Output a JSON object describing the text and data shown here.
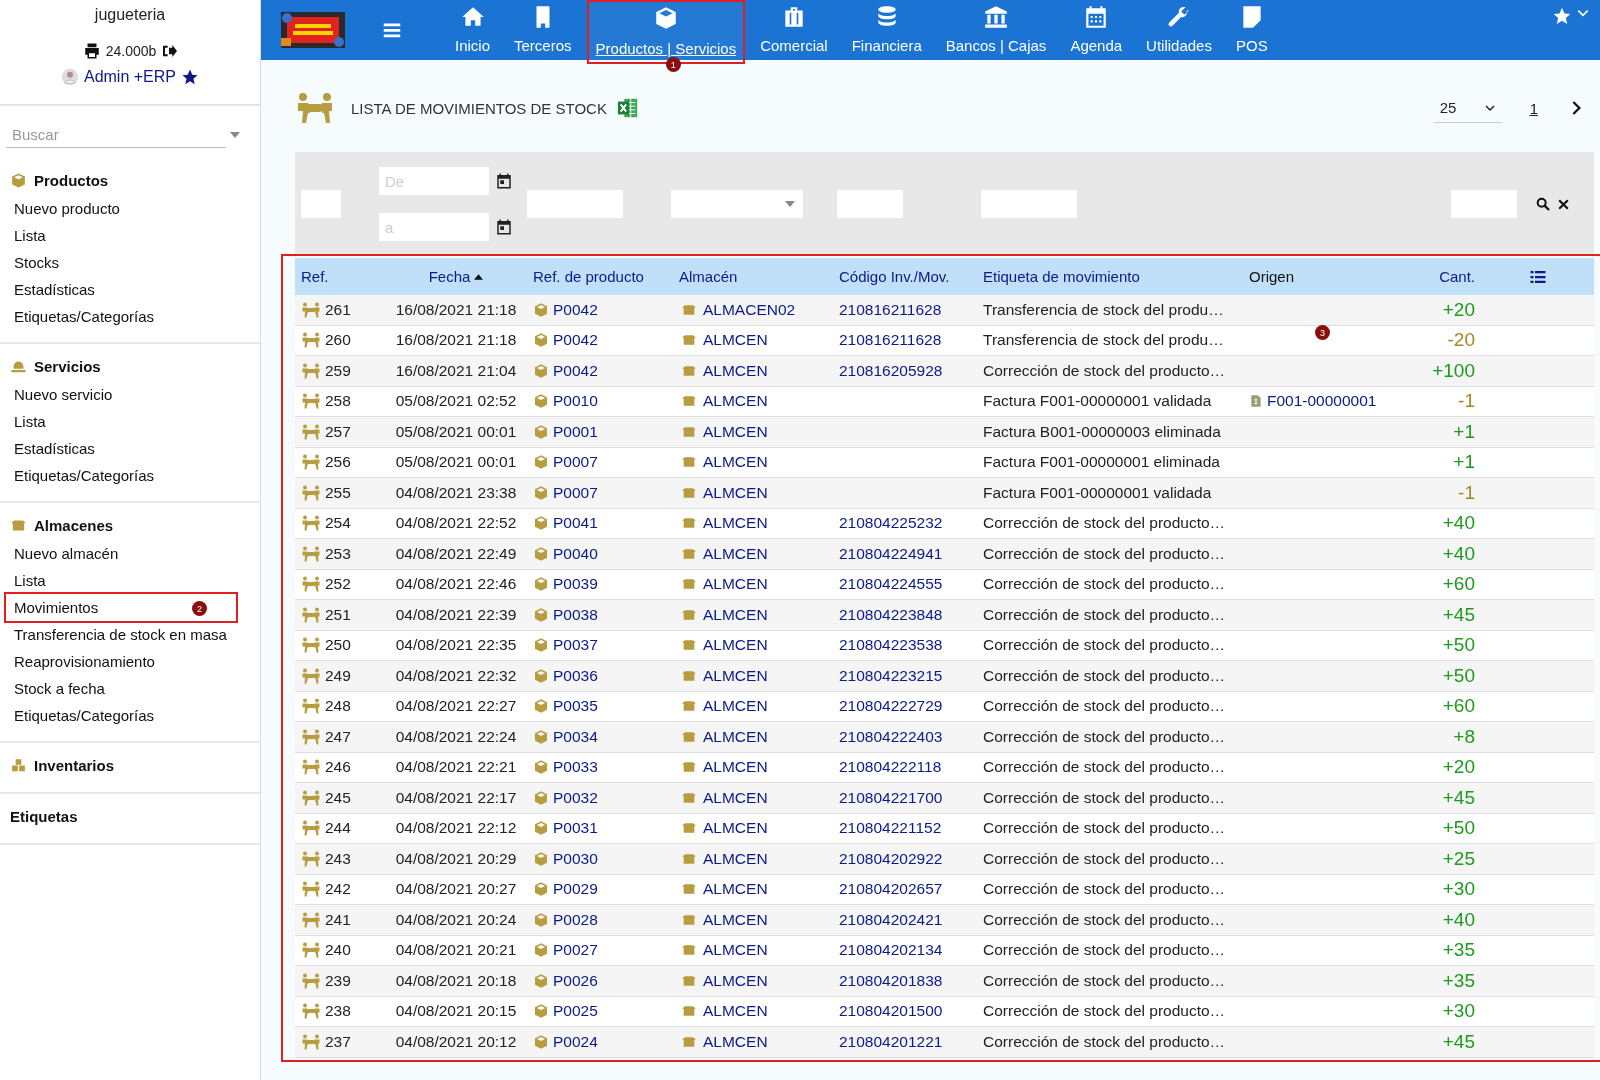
{
  "company": "jugueteria",
  "user_bar": {
    "printer_label": "24.000b",
    "user": "Admin +ERP"
  },
  "nav": [
    {
      "label": "Inicio",
      "selected": false
    },
    {
      "label": "Terceros",
      "selected": false
    },
    {
      "label": "Productos | Servicios",
      "selected": true,
      "annotation": "1"
    },
    {
      "label": "Comercial",
      "selected": false
    },
    {
      "label": "Financiera",
      "selected": false
    },
    {
      "label": "Bancos | Cajas",
      "selected": false
    },
    {
      "label": "Agenda",
      "selected": false
    },
    {
      "label": "Utilidades",
      "selected": false
    },
    {
      "label": "POS",
      "selected": false
    }
  ],
  "search": {
    "placeholder": "Buscar"
  },
  "sidebar": [
    {
      "title": "Productos",
      "items": [
        {
          "label": "Nuevo producto"
        },
        {
          "label": "Lista"
        },
        {
          "label": "Stocks"
        },
        {
          "label": "Estadísticas"
        },
        {
          "label": "Etiquetas/Categorías"
        }
      ]
    },
    {
      "title": "Servicios",
      "items": [
        {
          "label": "Nuevo servicio"
        },
        {
          "label": "Lista"
        },
        {
          "label": "Estadísticas"
        },
        {
          "label": "Etiquetas/Categorías"
        }
      ]
    },
    {
      "title": "Almacenes",
      "items": [
        {
          "label": "Nuevo almacén"
        },
        {
          "label": "Lista"
        },
        {
          "label": "Movimientos",
          "annotation": "2"
        },
        {
          "label": "Transferencia de stock en masa"
        },
        {
          "label": "Reaprovisionamiento"
        },
        {
          "label": "Stock a fecha"
        },
        {
          "label": "Etiquetas/Categorías"
        }
      ]
    },
    {
      "title": "Inventarios"
    },
    {
      "title": "Etiquetas"
    }
  ],
  "page_title": "LISTA DE MOVIMIENTOS DE STOCK",
  "pagination": {
    "page_size": "25",
    "page": "1"
  },
  "filters": {
    "date_from_placeholder": "De",
    "date_to_placeholder": "a"
  },
  "table": {
    "annotation": "3",
    "columns": [
      {
        "label": "Ref.",
        "sortable": true
      },
      {
        "label": "Fecha",
        "sortable": true
      },
      {
        "label": "Ref. de producto",
        "sortable": true
      },
      {
        "label": "Almacén",
        "sortable": true
      },
      {
        "label": "Código Inv./Mov.",
        "sortable": true
      },
      {
        "label": "Etiqueta de movimiento",
        "sortable": true
      },
      {
        "label": "Origen",
        "sortable": false
      },
      {
        "label": "Cant.",
        "sortable": true
      }
    ],
    "rows": [
      {
        "ref": "261",
        "date": "16/08/2021 21:18",
        "product": "P0042",
        "warehouse": "ALMACEN02",
        "code": "210816211628",
        "label": "Transferencia de stock del produ…",
        "qty": "+20",
        "incoming": true
      },
      {
        "ref": "260",
        "date": "16/08/2021 21:18",
        "product": "P0042",
        "warehouse": "ALMCEN",
        "code": "210816211628",
        "label": "Transferencia de stock del produ…",
        "qty": "-20",
        "incoming": false
      },
      {
        "ref": "259",
        "date": "16/08/2021 21:04",
        "product": "P0042",
        "warehouse": "ALMCEN",
        "code": "210816205928",
        "label": "Corrección de stock del producto…",
        "qty": "+100",
        "incoming": true
      },
      {
        "ref": "258",
        "date": "05/08/2021 02:52",
        "product": "P0010",
        "warehouse": "ALMCEN",
        "label": "Factura F001-00000001 validada",
        "origin": "F001-00000001",
        "qty": "-1",
        "incoming": false
      },
      {
        "ref": "257",
        "date": "05/08/2021 00:01",
        "product": "P0001",
        "warehouse": "ALMCEN",
        "label": "Factura B001-00000003 eliminada",
        "qty": "+1",
        "incoming": true
      },
      {
        "ref": "256",
        "date": "05/08/2021 00:01",
        "product": "P0007",
        "warehouse": "ALMCEN",
        "label": "Factura F001-00000001 eliminada",
        "qty": "+1",
        "incoming": true
      },
      {
        "ref": "255",
        "date": "04/08/2021 23:38",
        "product": "P0007",
        "warehouse": "ALMCEN",
        "label": "Factura F001-00000001 validada",
        "qty": "-1",
        "incoming": false
      },
      {
        "ref": "254",
        "date": "04/08/2021 22:52",
        "product": "P0041",
        "warehouse": "ALMCEN",
        "code": "210804225232",
        "label": "Corrección de stock del producto…",
        "qty": "+40",
        "incoming": true
      },
      {
        "ref": "253",
        "date": "04/08/2021 22:49",
        "product": "P0040",
        "warehouse": "ALMCEN",
        "code": "210804224941",
        "label": "Corrección de stock del producto…",
        "qty": "+40",
        "incoming": true
      },
      {
        "ref": "252",
        "date": "04/08/2021 22:46",
        "product": "P0039",
        "warehouse": "ALMCEN",
        "code": "210804224555",
        "label": "Corrección de stock del producto…",
        "qty": "+60",
        "incoming": true
      },
      {
        "ref": "251",
        "date": "04/08/2021 22:39",
        "product": "P0038",
        "warehouse": "ALMCEN",
        "code": "210804223848",
        "label": "Corrección de stock del producto…",
        "qty": "+45",
        "incoming": true
      },
      {
        "ref": "250",
        "date": "04/08/2021 22:35",
        "product": "P0037",
        "warehouse": "ALMCEN",
        "code": "210804223538",
        "label": "Corrección de stock del producto…",
        "qty": "+50",
        "incoming": true
      },
      {
        "ref": "249",
        "date": "04/08/2021 22:32",
        "product": "P0036",
        "warehouse": "ALMCEN",
        "code": "210804223215",
        "label": "Corrección de stock del producto…",
        "qty": "+50",
        "incoming": true
      },
      {
        "ref": "248",
        "date": "04/08/2021 22:27",
        "product": "P0035",
        "warehouse": "ALMCEN",
        "code": "210804222729",
        "label": "Corrección de stock del producto…",
        "qty": "+60",
        "incoming": true
      },
      {
        "ref": "247",
        "date": "04/08/2021 22:24",
        "product": "P0034",
        "warehouse": "ALMCEN",
        "code": "210804222403",
        "label": "Corrección de stock del producto…",
        "qty": "+8",
        "incoming": true
      },
      {
        "ref": "246",
        "date": "04/08/2021 22:21",
        "product": "P0033",
        "warehouse": "ALMCEN",
        "code": "210804222118",
        "label": "Corrección de stock del producto…",
        "qty": "+20",
        "incoming": true
      },
      {
        "ref": "245",
        "date": "04/08/2021 22:17",
        "product": "P0032",
        "warehouse": "ALMCEN",
        "code": "210804221700",
        "label": "Corrección de stock del producto…",
        "qty": "+45",
        "incoming": true
      },
      {
        "ref": "244",
        "date": "04/08/2021 22:12",
        "product": "P0031",
        "warehouse": "ALMCEN",
        "code": "210804221152",
        "label": "Corrección de stock del producto…",
        "qty": "+50",
        "incoming": true
      },
      {
        "ref": "243",
        "date": "04/08/2021 20:29",
        "product": "P0030",
        "warehouse": "ALMCEN",
        "code": "210804202922",
        "label": "Corrección de stock del producto…",
        "qty": "+25",
        "incoming": true
      },
      {
        "ref": "242",
        "date": "04/08/2021 20:27",
        "product": "P0029",
        "warehouse": "ALMCEN",
        "code": "210804202657",
        "label": "Corrección de stock del producto…",
        "qty": "+30",
        "incoming": true
      },
      {
        "ref": "241",
        "date": "04/08/2021 20:24",
        "product": "P0028",
        "warehouse": "ALMCEN",
        "code": "210804202421",
        "label": "Corrección de stock del producto…",
        "qty": "+40",
        "incoming": true
      },
      {
        "ref": "240",
        "date": "04/08/2021 20:21",
        "product": "P0027",
        "warehouse": "ALMCEN",
        "code": "210804202134",
        "label": "Corrección de stock del producto…",
        "qty": "+35",
        "incoming": true
      },
      {
        "ref": "239",
        "date": "04/08/2021 20:18",
        "product": "P0026",
        "warehouse": "ALMCEN",
        "code": "210804201838",
        "label": "Corrección de stock del producto…",
        "qty": "+35",
        "incoming": true
      },
      {
        "ref": "238",
        "date": "04/08/2021 20:15",
        "product": "P0025",
        "warehouse": "ALMCEN",
        "code": "210804201500",
        "label": "Corrección de stock del producto…",
        "qty": "+30",
        "incoming": true
      },
      {
        "ref": "237",
        "date": "04/08/2021 20:12",
        "product": "P0024",
        "warehouse": "ALMCEN",
        "code": "210804201221",
        "label": "Corrección de stock del producto…",
        "qty": "+45",
        "incoming": true
      }
    ]
  }
}
